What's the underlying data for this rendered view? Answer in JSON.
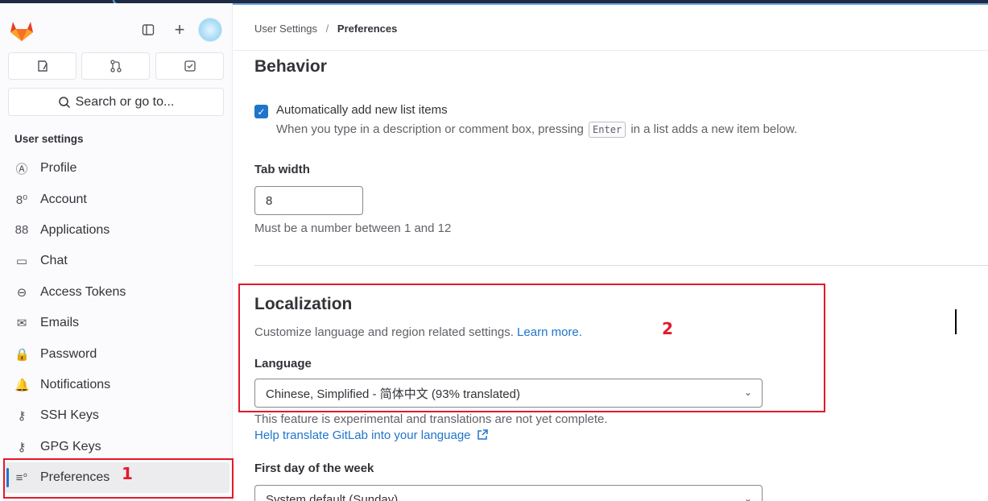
{
  "sidebar": {
    "search_label": "Search or go to...",
    "section_title": "User settings",
    "items": [
      {
        "label": "Profile",
        "icon": "profile-icon",
        "glyph": "Ⓐ"
      },
      {
        "label": "Account",
        "icon": "account-icon",
        "glyph": "8⁰"
      },
      {
        "label": "Applications",
        "icon": "applications-icon",
        "glyph": "88"
      },
      {
        "label": "Chat",
        "icon": "chat-icon",
        "glyph": "▭"
      },
      {
        "label": "Access Tokens",
        "icon": "token-icon",
        "glyph": "⊖"
      },
      {
        "label": "Emails",
        "icon": "mail-icon",
        "glyph": "✉"
      },
      {
        "label": "Password",
        "icon": "lock-icon",
        "glyph": "🔒"
      },
      {
        "label": "Notifications",
        "icon": "bell-icon",
        "glyph": "🔔"
      },
      {
        "label": "SSH Keys",
        "icon": "key-icon",
        "glyph": "⚷"
      },
      {
        "label": "GPG Keys",
        "icon": "key-icon",
        "glyph": "⚷"
      },
      {
        "label": "Preferences",
        "icon": "preferences-icon",
        "glyph": "≡°"
      }
    ],
    "active_index": 10
  },
  "annotations": {
    "marker_1": "1",
    "marker_2": "2",
    "color": "#e3192b"
  },
  "breadcrumb": {
    "parent": "User Settings",
    "separator": "/",
    "current": "Preferences"
  },
  "behavior": {
    "title": "Behavior",
    "auto_list_label": "Automatically add new list items",
    "auto_list_help_before": "When you type in a description or comment box, pressing",
    "auto_list_help_key": "Enter",
    "auto_list_help_after": "in a list adds a new item below.",
    "auto_list_checked": true,
    "tab_width_label": "Tab width",
    "tab_width_value": "8",
    "tab_width_help": "Must be a number between 1 and 12"
  },
  "localization": {
    "title": "Localization",
    "description": "Customize language and region related settings.",
    "learn_more": "Learn more.",
    "language_label": "Language",
    "language_value": "Chinese, Simplified - 简体中文 (93% translated)",
    "experimental_note": "This feature is experimental and translations are not yet complete.",
    "help_translate": "Help translate GitLab into your language",
    "first_day_label": "First day of the week",
    "first_day_value": "System default (Sunday)"
  },
  "colors": {
    "accent": "#1f75cb",
    "annotation": "#e3192b"
  }
}
